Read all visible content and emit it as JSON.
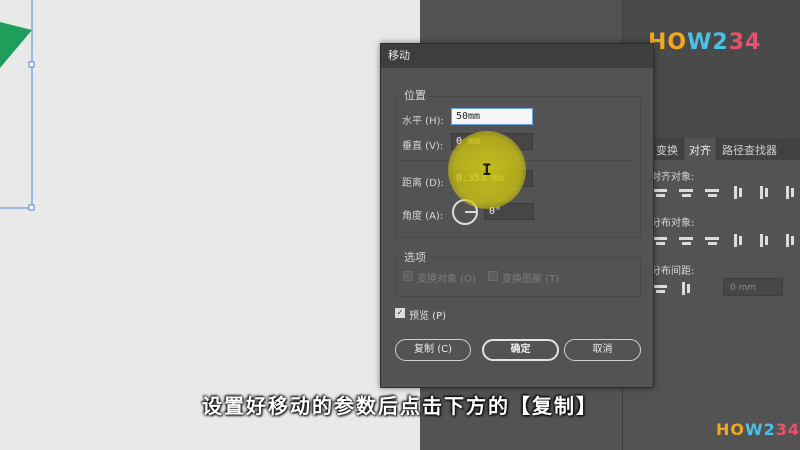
{
  "dialog": {
    "title": "移动",
    "position_group": "位置",
    "horizontal_label": "水平 (H):",
    "horizontal_value": "50mm",
    "vertical_label": "垂直 (V):",
    "vertical_value": "0",
    "vertical_unit": "mm",
    "distance_label": "距离 (D):",
    "distance_value": "0.353",
    "distance_unit": "mm",
    "angle_label": "角度 (A):",
    "angle_value": "0°",
    "options_group": "选项",
    "transform_objects": "变换对象 (O)",
    "transform_patterns": "变换图案 (T)",
    "preview_label": "预览 (P)",
    "copy_button": "复制 (C)",
    "ok_button": "确定",
    "cancel_button": "取消"
  },
  "panel": {
    "tabs": [
      "变换",
      "对齐",
      "路径查找器"
    ],
    "align_objects": "对齐对象:",
    "distribute_objects": "分布对象:",
    "distribute_spacing": "分布间距:",
    "spacing_value": "0 mm"
  },
  "watermark": {
    "logo": "HOW234",
    "logo_part1": "HO",
    "logo_part2": "W2",
    "logo_part3": "34"
  },
  "subtitle": "设置好移动的参数后点击下方的【复制】",
  "colors": {
    "canvas": "#e9e9e9",
    "ui_background": "#535353",
    "highlight": "#d6cc14",
    "shape_green": "#1e9e5a",
    "guide_blue": "#5b7fd6"
  }
}
